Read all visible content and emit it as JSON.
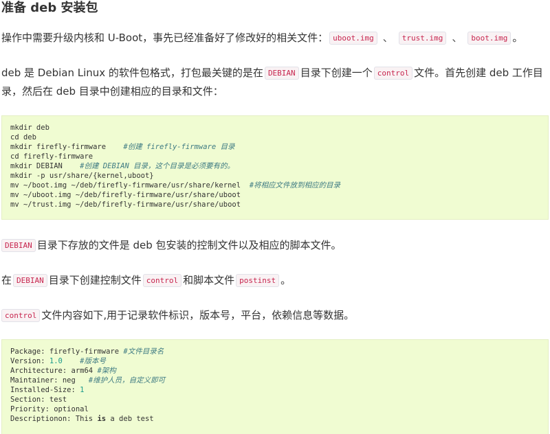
{
  "title": "准备 deb 安装包",
  "p1": {
    "text": "操作中需要升级内核和 U-Boot，事先已经准备好了修改好的相关文件：",
    "code1": "uboot.img",
    "sep1": "、",
    "code2": "trust.img",
    "sep2": "、",
    "code3": "boot.img",
    "end": "。"
  },
  "p2": {
    "t1": "deb 是 Debian Linux 的软件包格式，打包最关键的是在",
    "code1": "DEBIAN",
    "t2": "目录下创建一个",
    "code2": "control",
    "t3": "文件。首先创建 deb 工作目录，然后在 deb 目录中创建相应的目录和文件："
  },
  "code_block_1": {
    "lines": [
      {
        "cmd": "mkdir deb",
        "comment": ""
      },
      {
        "cmd": "cd deb",
        "comment": ""
      },
      {
        "cmd": "mkdir firefly-firmware    ",
        "comment": "#创建 firefly-firmware 目录"
      },
      {
        "cmd": "cd firefly-firmware",
        "comment": ""
      },
      {
        "cmd": "mkdir DEBIAN    ",
        "comment": "#创建 DEBIAN 目录，这个目录是必须要有的。"
      },
      {
        "cmd": "mkdir -p usr/share/{kernel,uboot}",
        "comment": ""
      },
      {
        "cmd": "mv ~/boot.img ~/deb/firefly-firmware/usr/share/kernel  ",
        "comment": "#将相应文件放到相应的目录"
      },
      {
        "cmd": "mv ~/uboot.img ~/deb/firefly-firmware/usr/share/uboot",
        "comment": ""
      },
      {
        "cmd": "mv ~/trust.img ~/deb/firefly-firmware/usr/share/uboot",
        "comment": ""
      }
    ]
  },
  "p3": {
    "code1": "DEBIAN",
    "text": "目录下存放的文件是 deb 包安装的控制文件以及相应的脚本文件。"
  },
  "p4": {
    "t1": "在",
    "code1": "DEBIAN",
    "t2": "目录下创建控制文件",
    "code2": "control",
    "t3": "和脚本文件",
    "code3": "postinst",
    "t4": "。"
  },
  "p5": {
    "code1": "control",
    "text": "文件内容如下,用于记录软件标识，版本号，平台，依赖信息等数据。"
  },
  "code_block_2": {
    "l1_key": "Package: firefly-firmware ",
    "l1_comment": "#文件目录名",
    "l2_key": "Version: ",
    "l2_num": "1.0",
    "l2_pad": "    ",
    "l2_comment": "#版本号",
    "l3_key": "Architecture: arm64 ",
    "l3_comment": "#架构",
    "l4_key": "Maintainer: neg   ",
    "l4_comment": "#维护人员，自定义即可",
    "l5_key": "Installed-Size: ",
    "l5_num": "1",
    "l6": "Section: test",
    "l7": "Priority: optional",
    "l8_a": "Descriptionon: This ",
    "l8_kw": "is",
    "l8_b": " a deb test"
  }
}
